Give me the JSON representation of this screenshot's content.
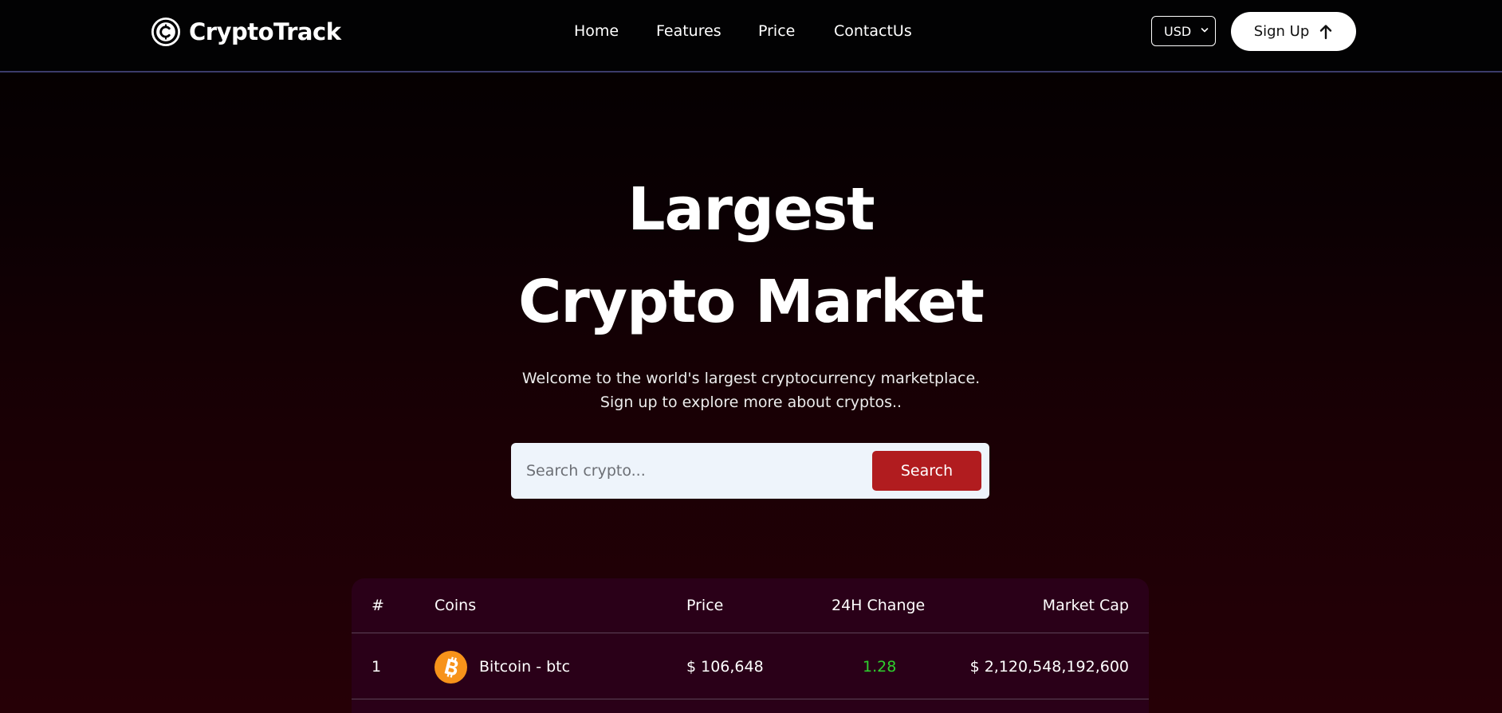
{
  "brand": {
    "name": "CryptoTrack"
  },
  "nav": {
    "items": [
      "Home",
      "Features",
      "Price",
      "ContactUs"
    ]
  },
  "currency": {
    "selected": "USD"
  },
  "signup": {
    "label": "Sign Up"
  },
  "hero": {
    "title_line1": "Largest",
    "title_line2": "Crypto Market",
    "subtitle_line1": "Welcome to the world's largest cryptocurrency marketplace.",
    "subtitle_line2": "Sign up to explore more about cryptos.."
  },
  "search": {
    "placeholder": "Search crypto...",
    "button_label": "Search"
  },
  "table": {
    "headers": {
      "rank": "#",
      "coins": "Coins",
      "price": "Price",
      "change": "24H Change",
      "market_cap": "Market Cap"
    },
    "rows": [
      {
        "rank": "1",
        "coin": "Bitcoin - btc",
        "icon": "bitcoin-icon",
        "price": "$ 106,648",
        "change": "1.28",
        "market_cap": "$ 2,120,548,192,600"
      }
    ]
  },
  "colors": {
    "accent": "#b11c1f",
    "positive": "#2ed12e",
    "table_bg": "#2a0018",
    "bitcoin": "#f7931a"
  }
}
